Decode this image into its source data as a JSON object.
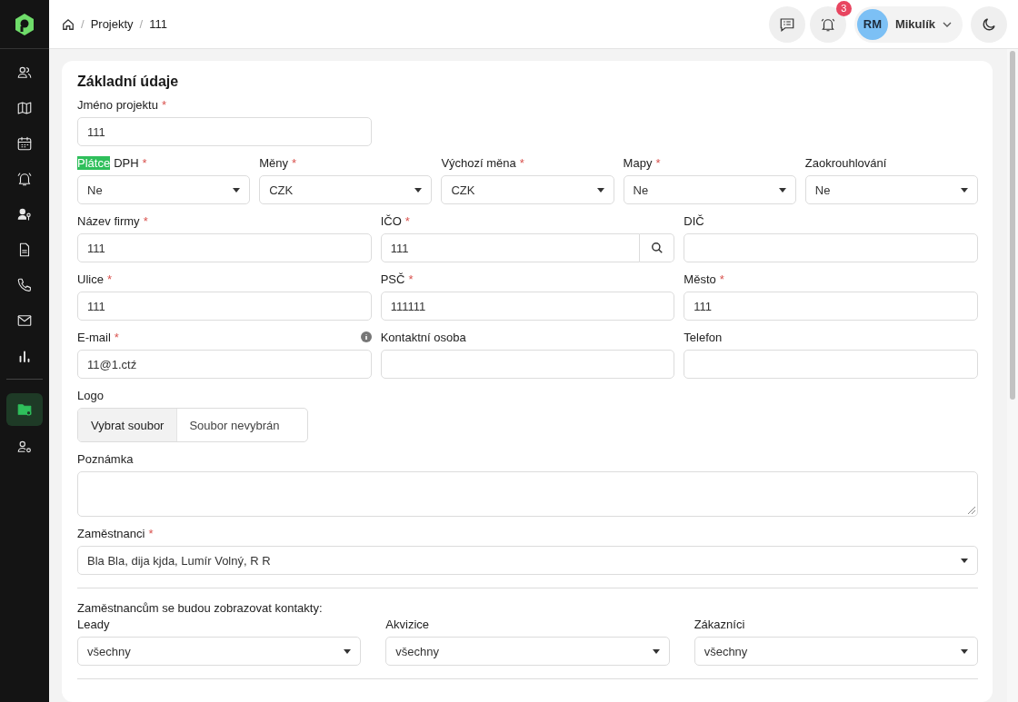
{
  "sidebar": {
    "items": [
      {
        "selected": false
      },
      {
        "selected": false
      },
      {
        "selected": false
      },
      {
        "selected": false
      },
      {
        "selected": false
      },
      {
        "selected": false
      },
      {
        "selected": false
      },
      {
        "selected": false
      },
      {
        "selected": false
      },
      {
        "selected": true
      },
      {
        "selected": false
      }
    ]
  },
  "header": {
    "breadcrumbs": [
      {
        "separator": "/",
        "label": "Projekty"
      },
      {
        "separator": "/",
        "label": "111"
      }
    ],
    "notifications": "3",
    "user": {
      "initials": "RM",
      "name": "Mikulík"
    }
  },
  "form": {
    "title": "Základní údaje",
    "rows": [
      {
        "fields": [
          {
            "kind": "text",
            "label": "Jméno projektu",
            "mark": "*",
            "value": "111"
          }
        ]
      },
      {
        "fields": [
          {
            "kind": "select",
            "selected_text": "Plátce",
            "label": "DPH",
            "mark": "*",
            "value": "Ne"
          },
          {
            "kind": "select",
            "label": "Měny",
            "mark": "*",
            "value": "CZK"
          },
          {
            "kind": "select",
            "label": "Výchozí měna",
            "mark": "*",
            "value": "CZK"
          },
          {
            "kind": "select",
            "label": "Mapy",
            "mark": "*",
            "value": "Ne"
          },
          {
            "kind": "select",
            "label": "Zaokrouhlování",
            "value": "Ne"
          }
        ]
      },
      {
        "fields": [
          {
            "kind": "text",
            "label": "Název firmy",
            "mark": "*",
            "value": "111"
          },
          {
            "kind": "search",
            "label": "IČO",
            "mark": "*",
            "value": "111"
          },
          {
            "kind": "text",
            "label": "DIČ"
          }
        ]
      },
      {
        "fields": [
          {
            "kind": "text",
            "label": "Ulice",
            "mark": "*",
            "value": "111"
          },
          {
            "kind": "text",
            "label": "PSČ",
            "mark": "*",
            "value": "111111"
          },
          {
            "kind": "text",
            "label": "Město",
            "mark": "*",
            "value": "111"
          }
        ]
      },
      {
        "fields": [
          {
            "kind": "text",
            "label": "E-mail",
            "mark": "*",
            "info": true,
            "value": "11@1.ctź"
          },
          {
            "kind": "text",
            "label": "Kontaktní osoba"
          },
          {
            "kind": "text",
            "label": "Telefon"
          }
        ]
      },
      {
        "fields": [
          {
            "kind": "file",
            "label": "Logo",
            "button": "Vybrat soubor",
            "value": "Soubor nevybrán"
          }
        ]
      },
      {
        "fields": [
          {
            "kind": "textarea",
            "label": "Poznámka"
          }
        ]
      },
      {
        "fields": [
          {
            "kind": "multiselect",
            "label": "Zaměstnanci",
            "mark": "*",
            "value": "Bla Bla, dija kjda, Lumír Volný, R R"
          }
        ]
      }
    ],
    "contacts": {
      "title": "Zaměstnancům se budou zobrazovat kontakty:",
      "fields": [
        {
          "kind": "select",
          "label": "Leady",
          "value": "všechny"
        },
        {
          "kind": "select",
          "label": "Akvizice",
          "value": "všechny"
        },
        {
          "kind": "select",
          "label": "Zákazníci",
          "value": "všechny"
        }
      ]
    }
  }
}
